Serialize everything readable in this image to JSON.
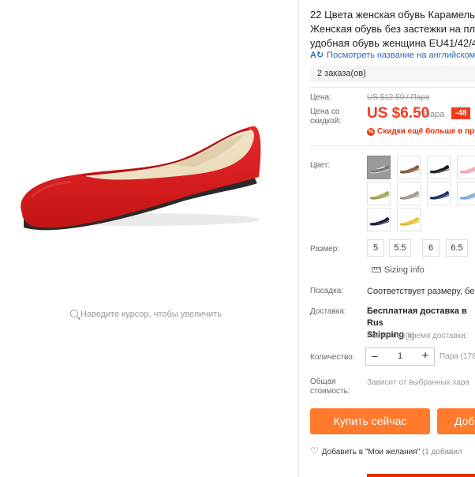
{
  "gallery": {
    "zoom_hint": "Наведите курсор, чтобы увеличить"
  },
  "product": {
    "title": "22 Цвета женская обувь Карамельны\nЖенская обувь без застежки на пло\nудобная обувь женщина EU41/42/4",
    "translate_link": "Посмотреть название на английском",
    "orders": "2 заказа(ов)"
  },
  "price": {
    "label": "Цена:",
    "old": "US $12.50 / Пара",
    "discount_label": "Цена со\nскидкой:",
    "current": "US $6.50",
    "unit": "/ Пара",
    "discount_badge": "-48",
    "promo": "Скидки ещё больше в при"
  },
  "color": {
    "label": "Цвет:",
    "swatches": [
      {
        "name": "grey-photo",
        "color": "#7a7a7a",
        "sole": "#d9d9d9",
        "selected": true
      },
      {
        "name": "brown",
        "color": "#8a5a3c",
        "sole": "#6b4430"
      },
      {
        "name": "black",
        "color": "#1a1a1a",
        "sole": "#2a2a2a"
      },
      {
        "name": "pink",
        "color": "#f4a6c0",
        "sole": "#e58aa8"
      },
      {
        "name": "olive",
        "color": "#a3a55a",
        "sole": "#878944"
      },
      {
        "name": "taupe",
        "color": "#a79a94",
        "sole": "#8b7f79"
      },
      {
        "name": "navy",
        "color": "#1f2f6b",
        "sole": "#16234f"
      },
      {
        "name": "light-blue",
        "color": "#7fb0e8",
        "sole": "#6493cc"
      },
      {
        "name": "dark-navy",
        "color": "#16213a",
        "sole": "#0e1628"
      },
      {
        "name": "yellow",
        "color": "#e8c528",
        "sole": "#c9a81c"
      }
    ]
  },
  "size": {
    "label": "Размер:",
    "options": [
      "5",
      "5.5",
      "6",
      "6.5"
    ],
    "sizing_info": "Sizing info"
  },
  "fit": {
    "label": "Посадка:",
    "value": "Соответствует размеру, бер"
  },
  "shipping": {
    "label": "Доставка:",
    "value_line1": "Бесплатная доставка в Rus",
    "value_line2": "Shipping",
    "dropdown_glyph": "v",
    "estimated": "Расчётное время доставки:"
  },
  "quantity": {
    "label": "Количество:",
    "minus": "−",
    "value": "1",
    "plus": "+",
    "stock": "Пара (178"
  },
  "total": {
    "label": "Общая\nстоимость:",
    "value": "Зависит от выбранных хара"
  },
  "actions": {
    "buy": "Купить сейчас",
    "cart": "Доб",
    "wishlist": "Добавить в \"Мои желания\"",
    "wishlist_count": "(1 добавил"
  },
  "colors": {
    "accent": "#ff7a2a",
    "price_red": "#f23b1e",
    "link_blue": "#2a6ab8",
    "shoe_red": "#d91a1a"
  }
}
